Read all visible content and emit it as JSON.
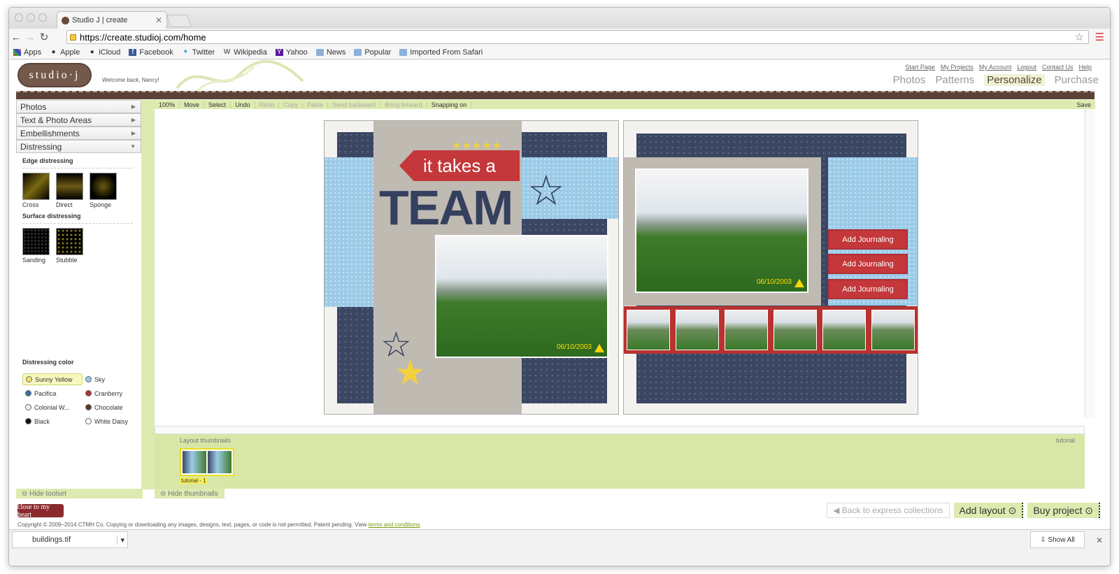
{
  "browser": {
    "tab_title": "Studio J | create",
    "url": "https://create.studioj.com/home",
    "bookmarks": [
      "Apps",
      "Apple",
      "iCloud",
      "Facebook",
      "Twitter",
      "Wikipedia",
      "Yahoo",
      "News",
      "Popular",
      "Imported From Safari"
    ]
  },
  "site": {
    "logo": "studio·j",
    "welcome": "Welcome back, Nancy!",
    "top_links": [
      "Start Page",
      "My Projects",
      "My Account",
      "Logout",
      "Contact Us",
      "Help"
    ],
    "main_nav": [
      "Photos",
      "Patterns",
      "Personalize",
      "Purchase"
    ],
    "active_nav": "Personalize"
  },
  "toolset": {
    "sections": [
      "Photos",
      "Text & Photo Areas",
      "Embellishments",
      "Distressing"
    ],
    "edge_title": "Edge distressing",
    "edge": [
      "Cross",
      "Direct",
      "Sponge"
    ],
    "surface_title": "Surface distressing",
    "surface": [
      "Sanding",
      "Stubble"
    ],
    "color_title": "Distressing color",
    "colors": [
      {
        "name": "Sunny Yellow",
        "hex": "#f2e26a"
      },
      {
        "name": "Sky",
        "hex": "#9ccbe8"
      },
      {
        "name": "Pacifica",
        "hex": "#3b6ea5"
      },
      {
        "name": "Cranberry",
        "hex": "#a8323a"
      },
      {
        "name": "Colonial W...",
        "hex": "#f6f2e6"
      },
      {
        "name": "Chocolate",
        "hex": "#5a3a22"
      },
      {
        "name": "Black",
        "hex": "#111111"
      },
      {
        "name": "White Daisy",
        "hex": "#ffffff"
      }
    ],
    "hide_label": "Hide toolset"
  },
  "editor_toolbar": {
    "zoom": "100%",
    "tools": [
      "Move",
      "Select",
      "Undo",
      "Redo",
      "Copy",
      "Paste",
      "Send backward",
      "Bring forward",
      "Snapping on"
    ],
    "save": "Save"
  },
  "layout": {
    "headline_small": "it takes a",
    "headline_big": "TEAM",
    "photo_date_left": "06/10/2003",
    "photo_date_right": "06/10/2003",
    "journaling": [
      "Add Journaling",
      "Add Journaling",
      "Add Journaling"
    ]
  },
  "thumbnails": {
    "title": "Layout thumbnails",
    "right_label": "tutorial",
    "item_label": "tutorial - 1",
    "hide_label": "Hide thumbnails"
  },
  "footer": {
    "back": "Back to express collections",
    "add_layout": "Add layout",
    "buy_project": "Buy project",
    "brand_logo": "close to my heart",
    "copyright": "Copyright © 2009–2014 CTMH Co. Copying or downloading any images, designs, text, pages, or code is not permitted. Patent pending. View",
    "terms": "terms and conditions"
  },
  "downloads": {
    "file": "buildings.tif",
    "show_all": "Show All"
  }
}
